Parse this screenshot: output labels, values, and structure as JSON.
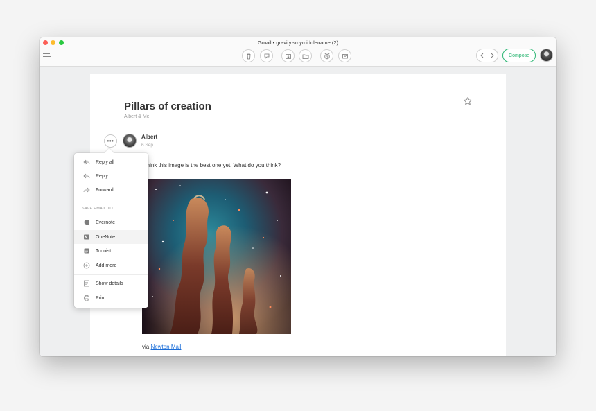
{
  "window": {
    "title": "Gmail • gravityismymiddlename (2)"
  },
  "toolbar": {
    "buttons": [
      "trash-icon",
      "spam-icon",
      "archive-icon",
      "folder-icon",
      "snooze-icon",
      "mark-unread-icon"
    ],
    "compose_label": "Compose"
  },
  "email": {
    "subject": "Pillars of creation",
    "participants": "Albert & Me",
    "sender": "Albert",
    "date": "6 Sep",
    "body": "I think this image is the best one yet. What do you think?",
    "via_prefix": "via",
    "via_link": "Newton Mail"
  },
  "menu": {
    "items": [
      {
        "label": "Reply all",
        "icon": "reply-all-icon"
      },
      {
        "label": "Reply",
        "icon": "reply-icon"
      },
      {
        "label": "Forward",
        "icon": "forward-icon"
      }
    ],
    "section_label": "SAVE EMAIL TO",
    "save_items": [
      {
        "label": "Evernote",
        "icon": "evernote-icon"
      },
      {
        "label": "OneNote",
        "icon": "onenote-icon"
      },
      {
        "label": "Todoist",
        "icon": "todoist-icon"
      },
      {
        "label": "Add more",
        "icon": "add-icon"
      }
    ],
    "bottom_items": [
      {
        "label": "Show details",
        "icon": "details-icon"
      },
      {
        "label": "Print",
        "icon": "print-icon"
      }
    ]
  },
  "colors": {
    "accent": "#2bb673",
    "link": "#1a6dd8"
  }
}
